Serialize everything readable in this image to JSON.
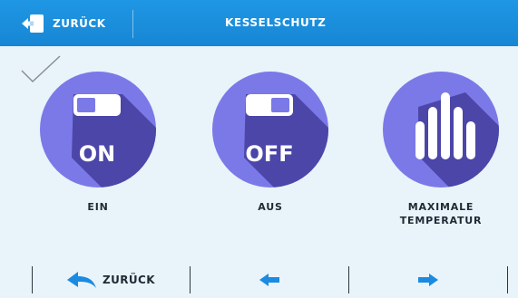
{
  "header": {
    "back_label": "ZURÜCK",
    "title": "KESSELSCHUTZ"
  },
  "tiles": [
    {
      "icon": "switch-on-icon",
      "badge": "ON",
      "caption": "EIN"
    },
    {
      "icon": "switch-off-icon",
      "badge": "OFF",
      "caption": "AUS"
    },
    {
      "icon": "temperature-bars-icon",
      "caption_line1": "MAXIMALE",
      "caption_line2": "TEMPERATUR"
    }
  ],
  "bottom_bar": {
    "back_label": "ZURÜCK"
  },
  "colors": {
    "header_blue": "#1a8be0",
    "circle_purple": "#7b79e8",
    "icon_shadow": "#4b46a8",
    "arrow_blue": "#1a8be0",
    "background": "#e9f3fa"
  }
}
